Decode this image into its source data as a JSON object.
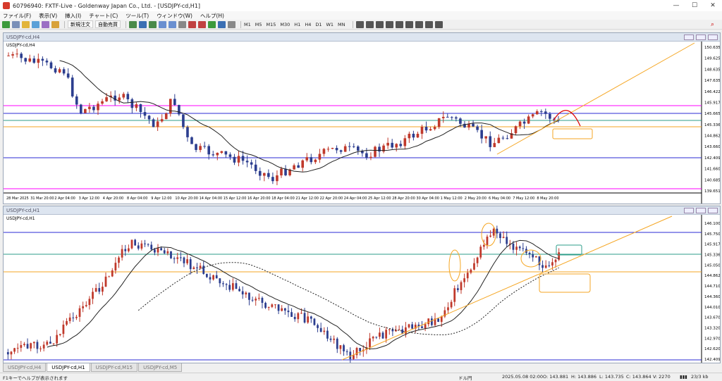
{
  "window": {
    "title": "60796940: FXTF-Live - Goldenway Japan Co., Ltd. - [USDJPY-cd,H1]"
  },
  "menu": [
    "ファイル(F)",
    "表示(V)",
    "挿入(I)",
    "チャート(C)",
    "ツール(T)",
    "ウィンドウ(W)",
    "ヘルプ(H)"
  ],
  "toolbar": {
    "new_order": "新規注文",
    "auto_trade": "自動売買",
    "timeframes": [
      "M1",
      "M5",
      "M15",
      "M30",
      "H1",
      "H4",
      "D1",
      "W1",
      "MN"
    ]
  },
  "chart_h4": {
    "window_title": "USDJPY-cd,H4",
    "label": "USDJPY-cd,H4",
    "price_axis": [
      "150.635",
      "149.625",
      "148.635",
      "147.635",
      "146.422",
      "145.917",
      "145.665",
      "145.336",
      "144.862",
      "143.660",
      "142.409",
      "141.660",
      "140.685",
      "139.651"
    ],
    "date_axis": [
      "28 Mar 2025",
      "31 Mar 20:00",
      "2 Apr 04:00",
      "3 Apr 12:00",
      "4 Apr 20:00",
      "8 Apr 04:00",
      "9 Apr 12:00",
      "10 Apr 20:00",
      "14 Apr 04:00",
      "15 Apr 12:00",
      "16 Apr 20:00",
      "18 Apr 04:00",
      "21 Apr 12:00",
      "22 Apr 20:00",
      "24 Apr 04:00",
      "25 Apr 12:00",
      "28 Apr 20:00",
      "30 Apr 04:00",
      "1 May 12:00",
      "2 May 20:00",
      "6 May 04:00",
      "7 May 12:00",
      "8 May 20:00"
    ]
  },
  "chart_h1": {
    "window_title": "USDJPY-cd,H1",
    "label": "USDJPY-cd,H1",
    "price_axis": [
      "146.100",
      "145.750",
      "145.917",
      "145.336",
      "145.050",
      "144.862",
      "144.710",
      "144.360",
      "144.010",
      "143.670",
      "143.320",
      "142.970",
      "142.620",
      "142.409"
    ]
  },
  "tabs": [
    "USDJPY-cd,H4",
    "USDJPY-cd,H1",
    "USDJPY-cd,M15",
    "USDJPY-cd,M5"
  ],
  "status": {
    "help": "F1キーでヘルプが表示されます",
    "profile": "ドル円",
    "datetime": "2025.05.08 02:00",
    "open": "O: 143.881",
    "high": "H: 143.886",
    "low": "L: 143.735",
    "close": "C: 143.864",
    "volume": "V: 2270",
    "traffic": "23/3 kb"
  },
  "colors": {
    "up": "#c0392b",
    "down": "#2c3e8f",
    "magenta_line": "#ff00ff",
    "blue_line": "#2b2bd6",
    "green_line": "#2e9e8a",
    "orange_line": "#f5a623"
  }
}
